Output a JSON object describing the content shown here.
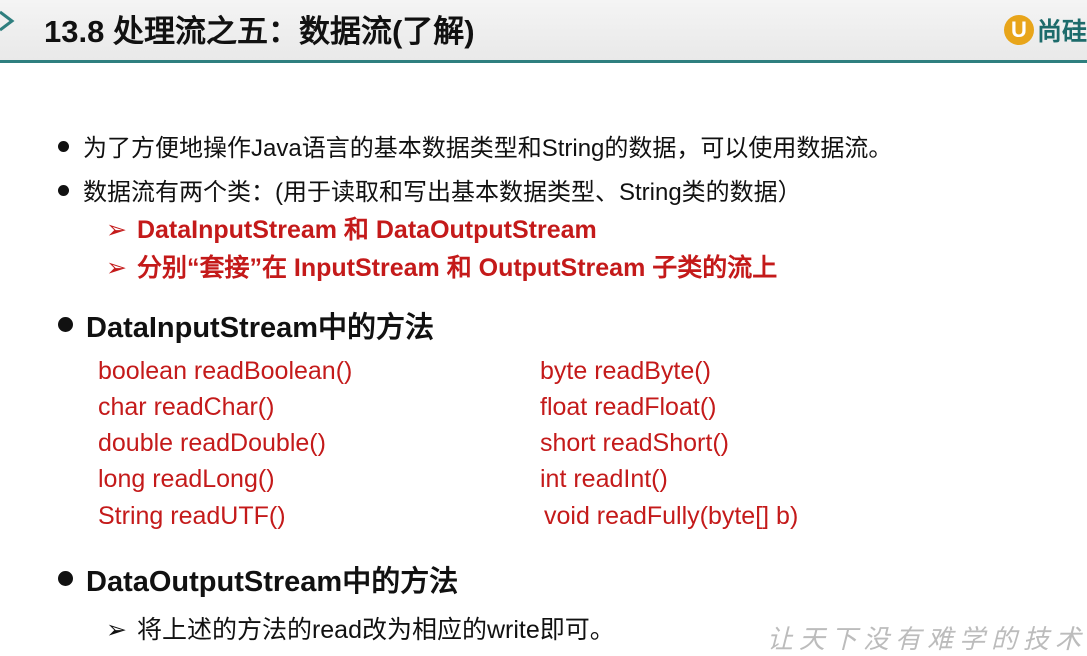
{
  "header": {
    "title": "13.8 处理流之五：数据流(了解)",
    "logo_text": "尚硅",
    "logo_mark": "U"
  },
  "bullets": [
    {
      "text": "为了方便地操作Java语言的基本数据类型和String的数据，可以使用数据流。"
    },
    {
      "text": "数据流有两个类：(用于读取和写出基本数据类型、String类的数据）"
    }
  ],
  "sub_bullets": [
    {
      "text": "DataInputStream 和 DataOutputStream"
    },
    {
      "text": "分别“套接”在 InputStream 和 OutputStream 子类的流上"
    }
  ],
  "input_section": {
    "heading": "DataInputStream中的方法",
    "methods_left": [
      "boolean readBoolean()",
      "char readChar()",
      "double readDouble()",
      "long readLong()",
      "String readUTF()"
    ],
    "methods_right": [
      "byte readByte()",
      "float readFloat()",
      "short readShort()",
      "int readInt()",
      "void readFully(byte[] b)"
    ]
  },
  "output_section": {
    "heading": "DataOutputStream中的方法",
    "note": "将上述的方法的read改为相应的write即可。"
  },
  "watermark": "让天下没有难学的技术",
  "colors": {
    "accent": "#c41a1a",
    "rule": "#2f7f7f",
    "logo": "#e8a51a"
  }
}
